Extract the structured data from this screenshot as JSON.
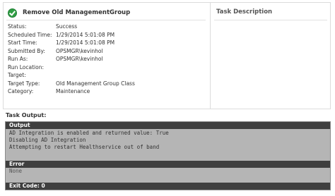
{
  "task": {
    "title": "Remove Old ManagementGroup",
    "status_icon": "success-check-icon",
    "status_color": "#2f9e44"
  },
  "description_panel": {
    "title": "Task Description"
  },
  "properties": [
    {
      "label": "Status:",
      "value": "Success"
    },
    {
      "label": "Scheduled Time:",
      "value": "1/29/2014 5:01:08 PM"
    },
    {
      "label": "Start Time:",
      "value": "1/29/2014 5:01:08 PM"
    },
    {
      "label": "Submitted By:",
      "value": "OPSMGR\\kevinhol"
    },
    {
      "label": "Run As:",
      "value": "OPSMGR\\kevinhol"
    },
    {
      "label": "Run Location:",
      "value": ""
    },
    {
      "label": "Target:",
      "value": ""
    },
    {
      "label": "Target Type:",
      "value": "Old Management Group Class"
    },
    {
      "label": "Category:",
      "value": "Maintenance"
    }
  ],
  "task_output": {
    "caption": "Task Output:",
    "output_header": "Output",
    "output_lines": [
      "AD Integration is enabled and returned value: True",
      "Disabling AD Integration",
      "Attempting to restart Healthservice out of band"
    ],
    "error_header": "Error",
    "error_text": "None",
    "exit_code": "Exit Code: 0"
  },
  "colors": {
    "output_background": "#b5b5b5",
    "section_header": "#3f3f3f"
  }
}
